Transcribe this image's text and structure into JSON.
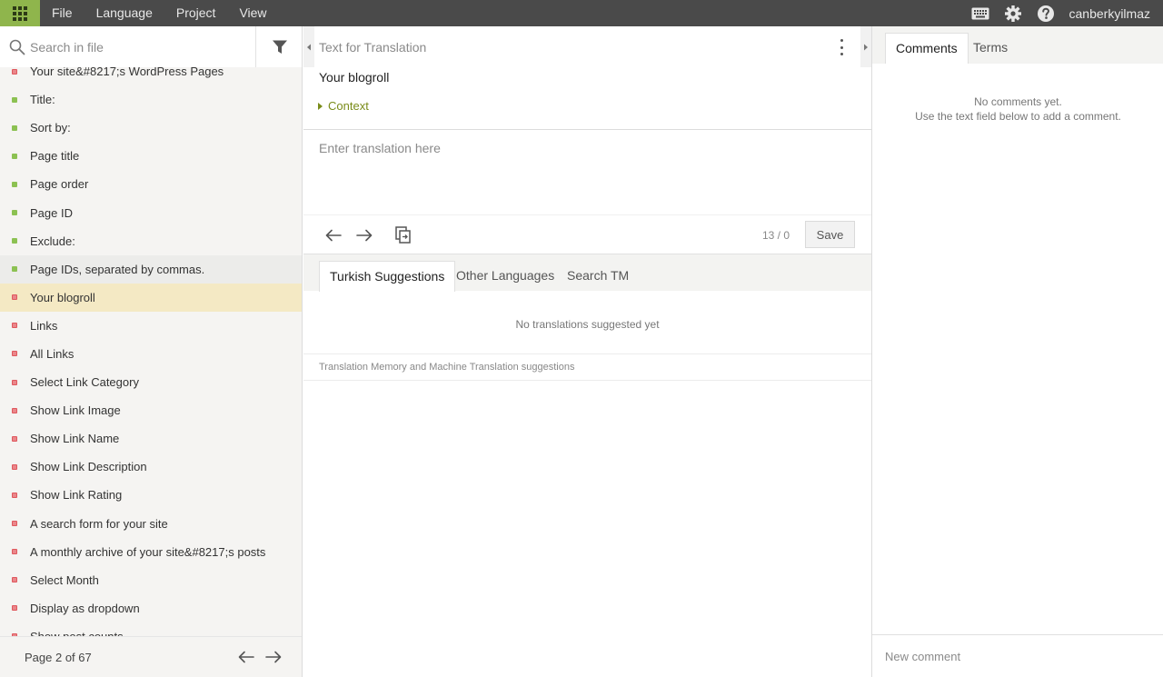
{
  "menu": {
    "file": "File",
    "language": "Language",
    "project": "Project",
    "view": "View"
  },
  "user": {
    "name": "canberkyilmaz"
  },
  "icons": {
    "apps": "apps-grid-icon",
    "keyboard": "keyboard-icon",
    "settings": "gear-icon",
    "help": "help-icon"
  },
  "sidebar": {
    "search_placeholder": "Search in file",
    "items": [
      {
        "label": "Your site&#8217;s WordPress Pages",
        "status": "red"
      },
      {
        "label": "Title:",
        "status": "green"
      },
      {
        "label": "Sort by:",
        "status": "green"
      },
      {
        "label": "Page title",
        "status": "green"
      },
      {
        "label": "Page order",
        "status": "green"
      },
      {
        "label": "Page ID",
        "status": "green"
      },
      {
        "label": "Exclude:",
        "status": "green"
      },
      {
        "label": "Page IDs, separated by commas.",
        "status": "green"
      },
      {
        "label": "Your blogroll",
        "status": "red"
      },
      {
        "label": "Links",
        "status": "red"
      },
      {
        "label": "All Links",
        "status": "red"
      },
      {
        "label": "Select Link Category",
        "status": "red"
      },
      {
        "label": "Show Link Image",
        "status": "red"
      },
      {
        "label": "Show Link Name",
        "status": "red"
      },
      {
        "label": "Show Link Description",
        "status": "red"
      },
      {
        "label": "Show Link Rating",
        "status": "red"
      },
      {
        "label": "A search form for your site",
        "status": "red"
      },
      {
        "label": "A monthly archive of your site&#8217;s posts",
        "status": "red"
      },
      {
        "label": "Select Month",
        "status": "red"
      },
      {
        "label": "Display as dropdown",
        "status": "red"
      },
      {
        "label": "Show post counts",
        "status": "red"
      }
    ],
    "pagination": "Page 2 of 67"
  },
  "source": {
    "header": "Text for Translation",
    "text": "Your blogroll",
    "context_label": "Context"
  },
  "translation": {
    "placeholder": "Enter translation here",
    "counter": "13 / 0",
    "save_label": "Save"
  },
  "suggestions": {
    "tabs": [
      "Turkish Suggestions",
      "Other Languages",
      "Search TM"
    ],
    "empty_text": "No translations suggested yet",
    "note": "Translation Memory and Machine Translation suggestions"
  },
  "comments": {
    "tabs": [
      "Comments",
      "Terms"
    ],
    "empty_line1": "No comments yet.",
    "empty_line2": "Use the text field below to add a comment.",
    "placeholder": "New comment"
  },
  "colors": {
    "accent": "#8fb54c",
    "topbar": "#4a4a4a",
    "selected_row": "#f4e9c4",
    "translated": "#8cc152",
    "untranslated": "#e9868a"
  }
}
